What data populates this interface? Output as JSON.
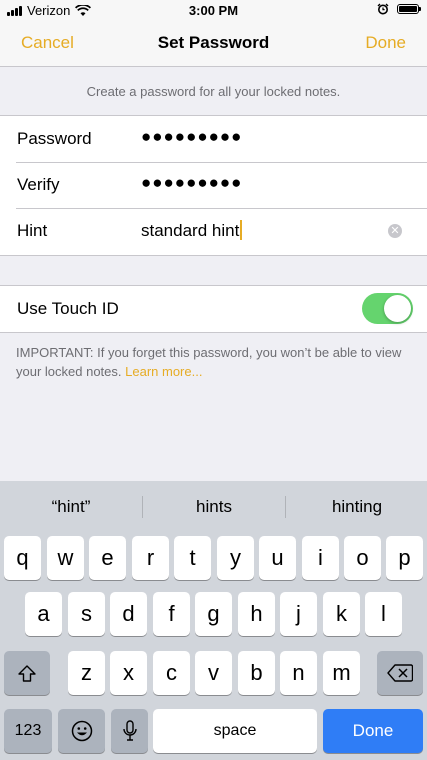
{
  "status": {
    "carrier": "Verizon",
    "time": "3:00 PM"
  },
  "nav": {
    "cancel": "Cancel",
    "title": "Set Password",
    "done": "Done"
  },
  "header_text": "Create a password for all your locked notes.",
  "fields": {
    "password": {
      "label": "Password",
      "value": "●●●●●●●●●"
    },
    "verify": {
      "label": "Verify",
      "value": "●●●●●●●●●"
    },
    "hint": {
      "label": "Hint",
      "value": "standard hint"
    }
  },
  "touch_id": {
    "label": "Use Touch ID",
    "on": true
  },
  "footnote": {
    "text": "IMPORTANT: If you forget this password, you won’t be able to view your locked notes.",
    "link": "Learn more..."
  },
  "keyboard": {
    "suggestions": [
      "“hint”",
      "hints",
      "hinting"
    ],
    "row1": [
      "q",
      "w",
      "e",
      "r",
      "t",
      "y",
      "u",
      "i",
      "o",
      "p"
    ],
    "row2": [
      "a",
      "s",
      "d",
      "f",
      "g",
      "h",
      "j",
      "k",
      "l"
    ],
    "row3": [
      "z",
      "x",
      "c",
      "v",
      "b",
      "n",
      "m"
    ],
    "numbers_key": "123",
    "space_key": "space",
    "done_key": "Done"
  },
  "colors": {
    "accent": "#e6ac25",
    "toggle_on": "#65d46e",
    "done_key": "#2f7df6"
  }
}
